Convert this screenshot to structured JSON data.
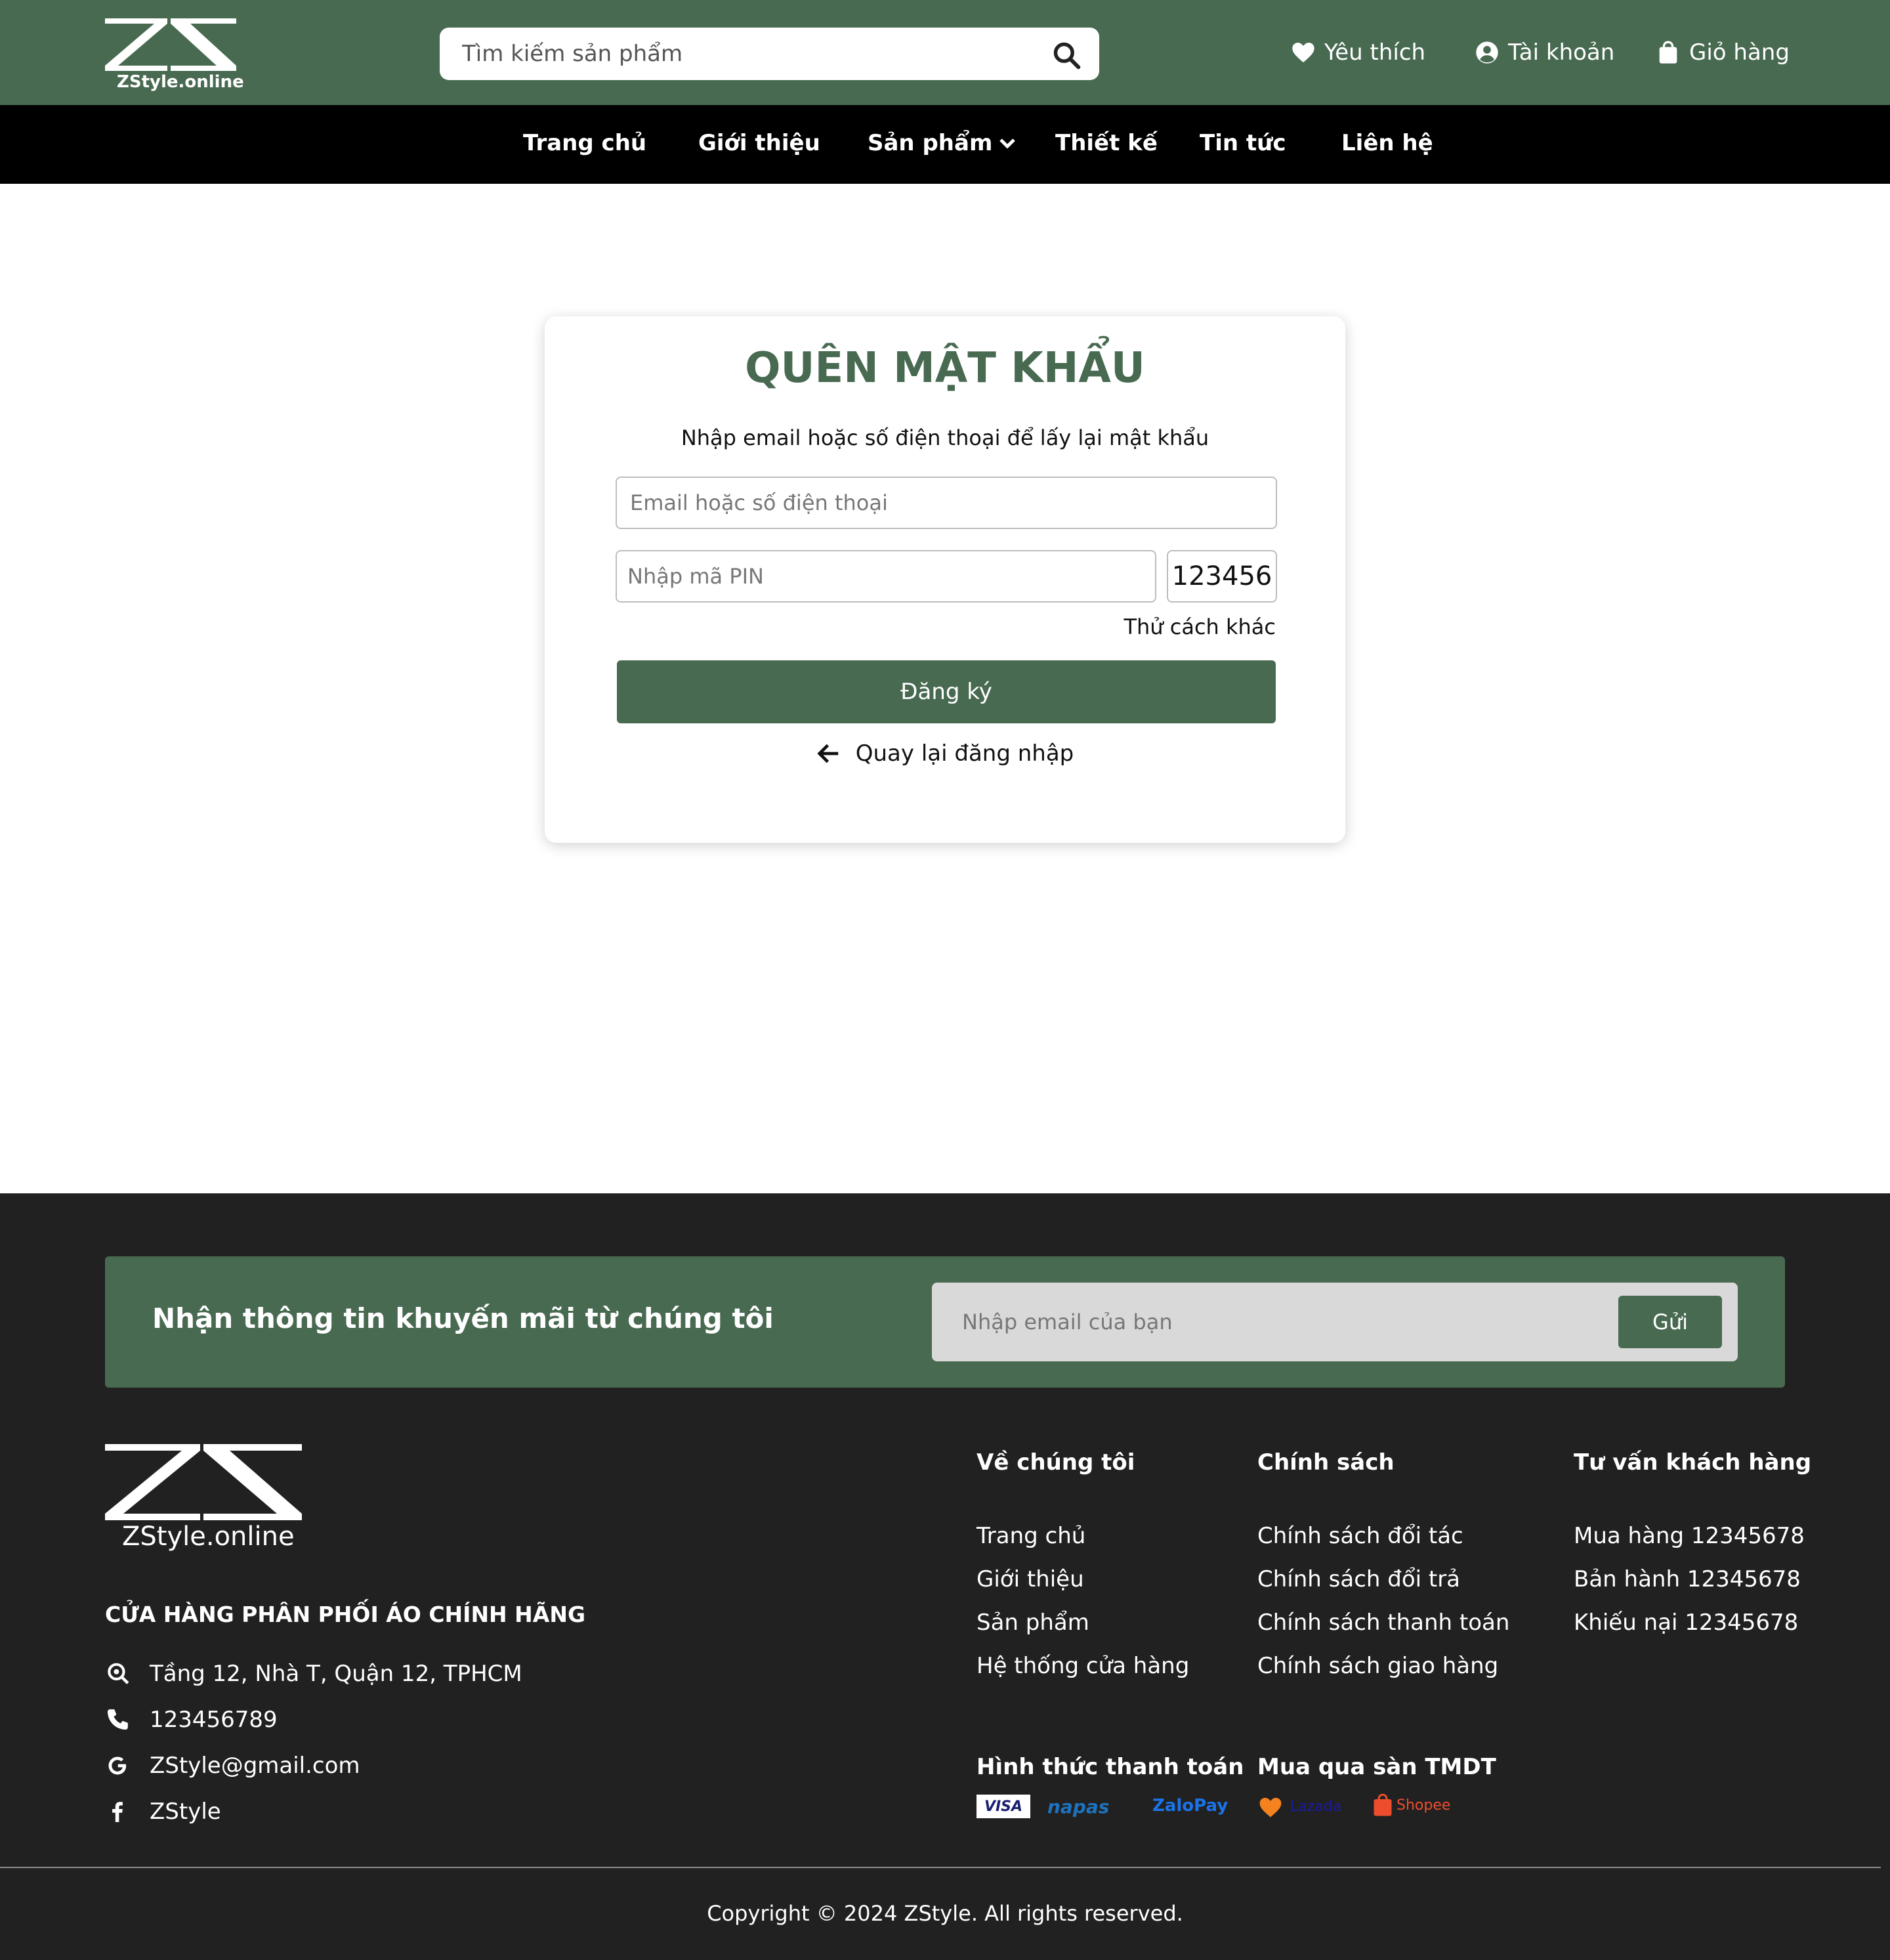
{
  "header": {
    "logo_text": "ZStyle.online",
    "search_placeholder": "Tìm kiếm sản phẩm",
    "links": {
      "favorites": "Yêu thích",
      "account": "Tài khoản",
      "cart": "Giỏ hàng"
    }
  },
  "nav": [
    "Trang chủ",
    "Giới thiệu",
    "Sản phẩm",
    "Thiết kế",
    "Tin tức",
    "Liên hệ"
  ],
  "form": {
    "title": "QUÊN MẬT KHẨU",
    "subtitle": "Nhập email hoặc số điện thoại để lấy lại mật khẩu",
    "email_placeholder": "Email hoặc số điện thoại",
    "pin_placeholder": "Nhập mã PIN",
    "pin_code": "123456",
    "alt_link": "Thử cách khác",
    "submit_label": "Đăng ký",
    "back_label": "Quay lại đăng nhập"
  },
  "footer": {
    "promo_title": "Nhận thông tin khuyến mãi từ chúng tôi",
    "promo_placeholder": "Nhập email của bạn",
    "promo_button": "Gửi",
    "logo_text": "ZStyle.online",
    "tagline": "CỬA HÀNG PHÂN PHỐI ÁO CHÍNH HÃNG",
    "contacts": {
      "address": "Tầng 12, Nhà T, Quận 12, TPHCM",
      "phone": "123456789",
      "email": "ZStyle@gmail.com",
      "facebook": "ZStyle"
    },
    "columns": [
      {
        "title": "Về chúng tôi",
        "items": [
          "Trang chủ",
          "Giới thiệu",
          "Sản phẩm",
          "Hệ thống cửa hàng"
        ]
      },
      {
        "title": "Chính sách",
        "items": [
          "Chính sách đổi tác",
          "Chính sách đổi trả",
          "Chính sách thanh toán",
          "Chính sách giao hàng"
        ]
      },
      {
        "title": "Tư vấn khách hàng",
        "items": [
          "Mua hàng 12345678",
          "Bản hành 12345678",
          "Khiếu nại 12345678"
        ]
      }
    ],
    "payment_title": "Hình thức thanh toán",
    "payment_methods": [
      "VISA",
      "napas",
      "ZaloPay"
    ],
    "marketplace_title": "Mua qua sàn TMDT",
    "marketplaces": [
      "Lazada",
      "Shopee"
    ],
    "copyright": "Copyright © 2024 ZStyle. All rights reserved."
  },
  "colors": {
    "brand_green": "#486a51",
    "nav_black": "#000000",
    "footer_dark": "#212121",
    "promo_input": "#d9d9d9"
  }
}
